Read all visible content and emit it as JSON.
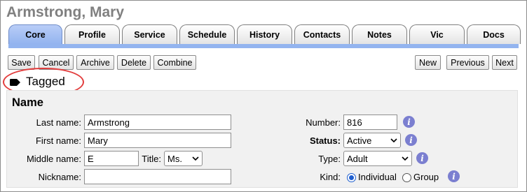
{
  "record": {
    "title": "Armstrong, Mary"
  },
  "tabs": [
    {
      "label": "Core",
      "active": true
    },
    {
      "label": "Profile"
    },
    {
      "label": "Service"
    },
    {
      "label": "Schedule"
    },
    {
      "label": "History"
    },
    {
      "label": "Contacts"
    },
    {
      "label": "Notes"
    },
    {
      "label": "Vic"
    },
    {
      "label": "Docs"
    }
  ],
  "toolbar": {
    "save": "Save",
    "cancel": "Cancel",
    "archive": "Archive",
    "delete": "Delete",
    "combine": "Combine",
    "new": "New",
    "previous": "Previous",
    "next": "Next"
  },
  "tag": {
    "label": "Tagged",
    "highlight_color": "#e23c3c"
  },
  "section": {
    "title": "Name"
  },
  "form": {
    "last_name": {
      "label": "Last name:",
      "value": "Armstrong"
    },
    "first_name": {
      "label": "First name:",
      "value": "Mary"
    },
    "middle_name": {
      "label": "Middle name:",
      "value": "E"
    },
    "title": {
      "label": "Title:",
      "value": "Ms."
    },
    "nickname": {
      "label": "Nickname:",
      "value": ""
    },
    "number": {
      "label": "Number:",
      "value": "816"
    },
    "status": {
      "label": "Status:",
      "value": "Active"
    },
    "type": {
      "label": "Type:",
      "value": "Adult"
    },
    "kind": {
      "label": "Kind:",
      "options": [
        "Individual",
        "Group"
      ],
      "selected": "Individual"
    },
    "info_glyph": "i"
  },
  "colors": {
    "accent_tab": "#93b4ef",
    "info": "#7b7fd0"
  }
}
